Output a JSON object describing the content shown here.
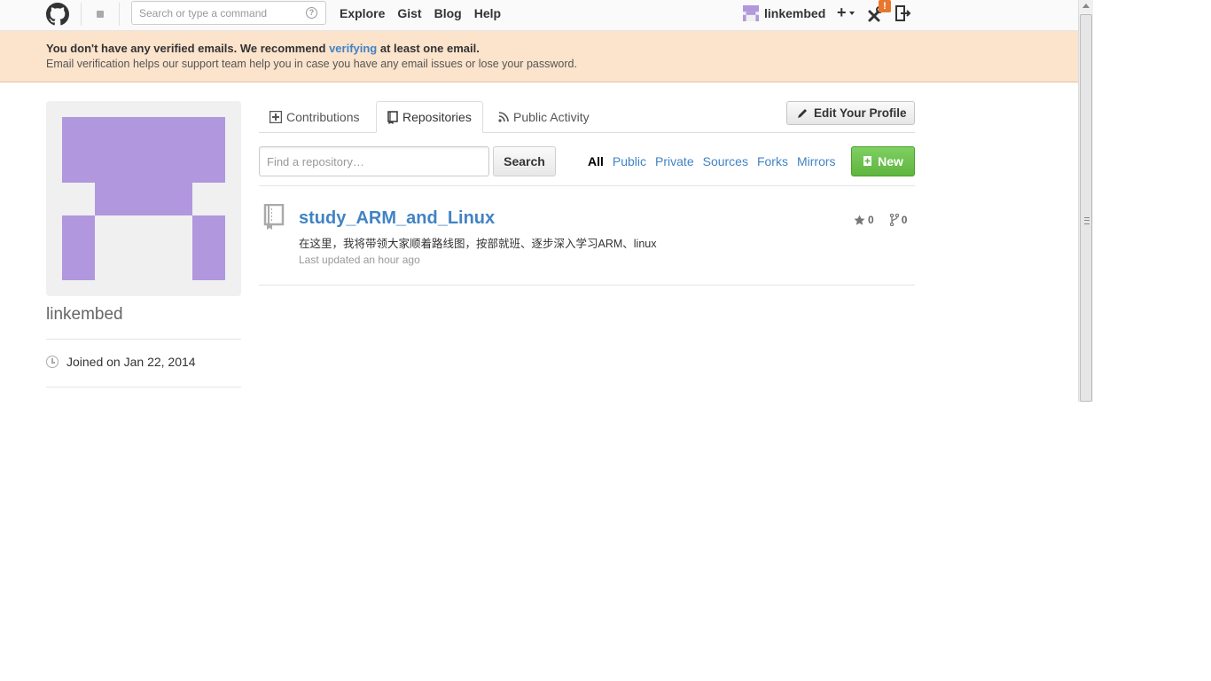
{
  "header": {
    "command_placeholder": "Search or type a command",
    "help_glyph": "?",
    "nav": [
      "Explore",
      "Gist",
      "Blog",
      "Help"
    ],
    "username": "linkembed",
    "create_label": "+",
    "alert_badge": "!"
  },
  "flash": {
    "line1_prefix": "You don't have any verified emails. We recommend",
    "line1_link": "verifying",
    "line1_suffix": "at least one email.",
    "line2": "Email verification helps our support team help you in case you have any email issues or lose your password."
  },
  "profile": {
    "name": "linkembed",
    "joined": "Joined on Jan 22, 2014",
    "avatar_color": "#b197dd"
  },
  "tabs": [
    {
      "label": "Contributions",
      "icon": "contributions-icon"
    },
    {
      "label": "Repositories",
      "icon": "repo-book-icon"
    },
    {
      "label": "Public Activity",
      "icon": "rss-icon"
    }
  ],
  "edit_profile_label": "Edit Your Profile",
  "filter": {
    "placeholder": "Find a repository…",
    "search_label": "Search",
    "types": [
      "All",
      "Public",
      "Private",
      "Sources",
      "Forks",
      "Mirrors"
    ],
    "selected": "All",
    "new_label": "New"
  },
  "repos": [
    {
      "name": "study_ARM_and_Linux",
      "description": "在这里，我将带领大家顺着路线图，按部就班、逐步深入学习ARM、linux",
      "updated": "Last updated an hour ago",
      "stars": "0",
      "forks": "0"
    }
  ],
  "colors": {
    "link": "#4183c4",
    "flash_bg": "#fbe3cc",
    "new_button": "#6cc644",
    "alert": "#e8772e"
  }
}
